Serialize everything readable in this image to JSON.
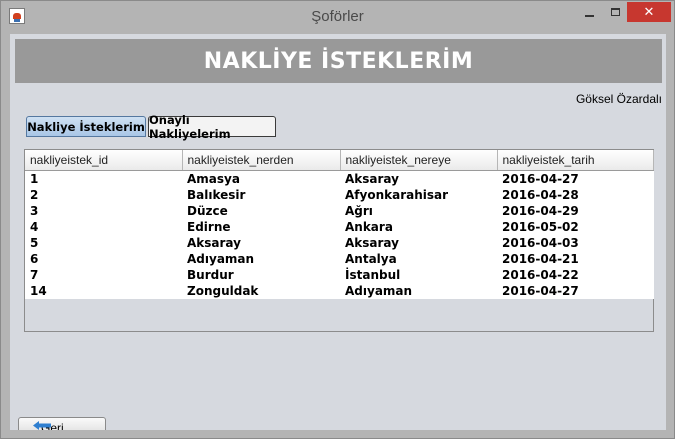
{
  "window": {
    "title": "Şoförler",
    "close_glyph": "✕",
    "icons": [
      "java-app-icon",
      "minimize-icon",
      "maximize-icon",
      "close-icon"
    ]
  },
  "banner": {
    "title": "NAKLİYE İSTEKLERİM"
  },
  "user": {
    "name": "Göksel Özardalı"
  },
  "tabs": [
    {
      "label": "Nakliye İsteklerim",
      "selected": true
    },
    {
      "label": "Onaylı Nakliyelerim",
      "selected": false
    }
  ],
  "table": {
    "columns": [
      "nakliyeistek_id",
      "nakliyeistek_nerden",
      "nakliyeistek_nereye",
      "nakliyeistek_tarih"
    ],
    "rows": [
      [
        "1",
        "Amasya",
        "Aksaray",
        "2016-04-27"
      ],
      [
        "2",
        "Balıkesir",
        "Afyonkarahisar",
        "2016-04-28"
      ],
      [
        "3",
        "Düzce",
        "Ağrı",
        "2016-04-29"
      ],
      [
        "4",
        "Edirne",
        "Ankara",
        "2016-05-02"
      ],
      [
        "5",
        "Aksaray",
        "Aksaray",
        "2016-04-03"
      ],
      [
        "6",
        "Adıyaman",
        "Antalya",
        "2016-04-21"
      ],
      [
        "7",
        "Burdur",
        "İstanbul",
        "2016-04-22"
      ],
      [
        "14",
        "Zonguldak",
        "Adıyaman",
        "2016-04-27"
      ]
    ]
  },
  "back_button": {
    "label": "Geri",
    "icon": "back-arrow-icon"
  },
  "colors": {
    "frame": "#b4b4b4",
    "client": "#d6d9df",
    "banner": "#999999",
    "close_button": "#c7372f",
    "active_tab": "#b9d1ec"
  }
}
